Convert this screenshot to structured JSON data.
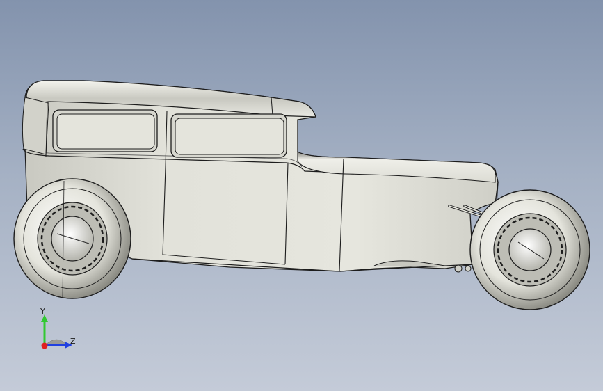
{
  "viewport": {
    "background_top": "#8393ad",
    "background_bottom": "#c4cbd8"
  },
  "model": {
    "body_color": "#d9d9d1",
    "shadow_color": "#8e8e86",
    "outline_color": "#1d1d1d"
  },
  "triad": {
    "y_label": "Y",
    "z_label": "Z",
    "y_color": "#32c832",
    "z_color": "#2040e0",
    "x_color": "#e02020",
    "icon": "view-orientation-triad-icon"
  }
}
